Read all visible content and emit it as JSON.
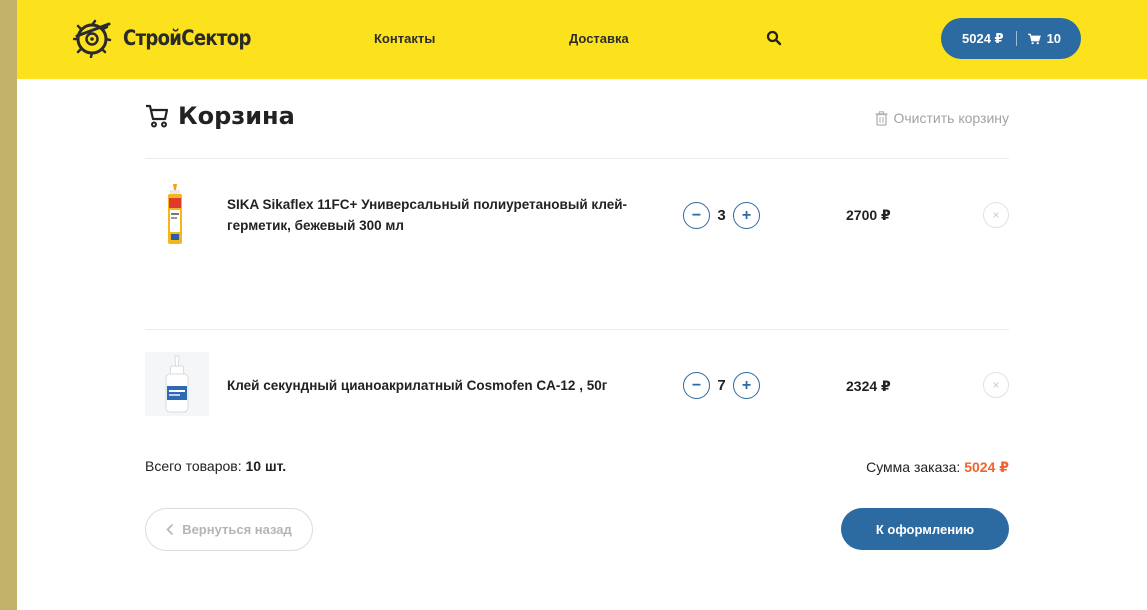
{
  "header": {
    "logo_text": "СтройСектор",
    "nav": [
      "Контакты",
      "Доставка"
    ],
    "cart_sum": "5024 ₽",
    "cart_count": "10"
  },
  "cart": {
    "title": "Корзина",
    "clear_label": "Очистить корзину",
    "items": [
      {
        "name": "SIKA Sikaflex 11FC+ Универсальный полиуретановый клей-герметик, бежевый 300 мл",
        "qty": "3",
        "price": "2700 ₽",
        "minus": "−",
        "plus": "+",
        "remove": "×"
      },
      {
        "name": "Клей секундный цианоакрилатный Cosmofen CA-12 , 50г",
        "qty": "7",
        "price": "2324 ₽",
        "minus": "−",
        "plus": "+",
        "remove": "×"
      }
    ],
    "total_items_label": "Всего товаров:",
    "total_items_value": "10 шт.",
    "order_sum_label": "Сумма заказа:",
    "order_sum_value": "5024 ₽",
    "back_label": "Вернуться назад",
    "checkout_label": "К оформлению"
  },
  "colors": {
    "header_bg": "#fce21c",
    "accent": "#2c6aa2",
    "sum_highlight": "#f0632b"
  }
}
